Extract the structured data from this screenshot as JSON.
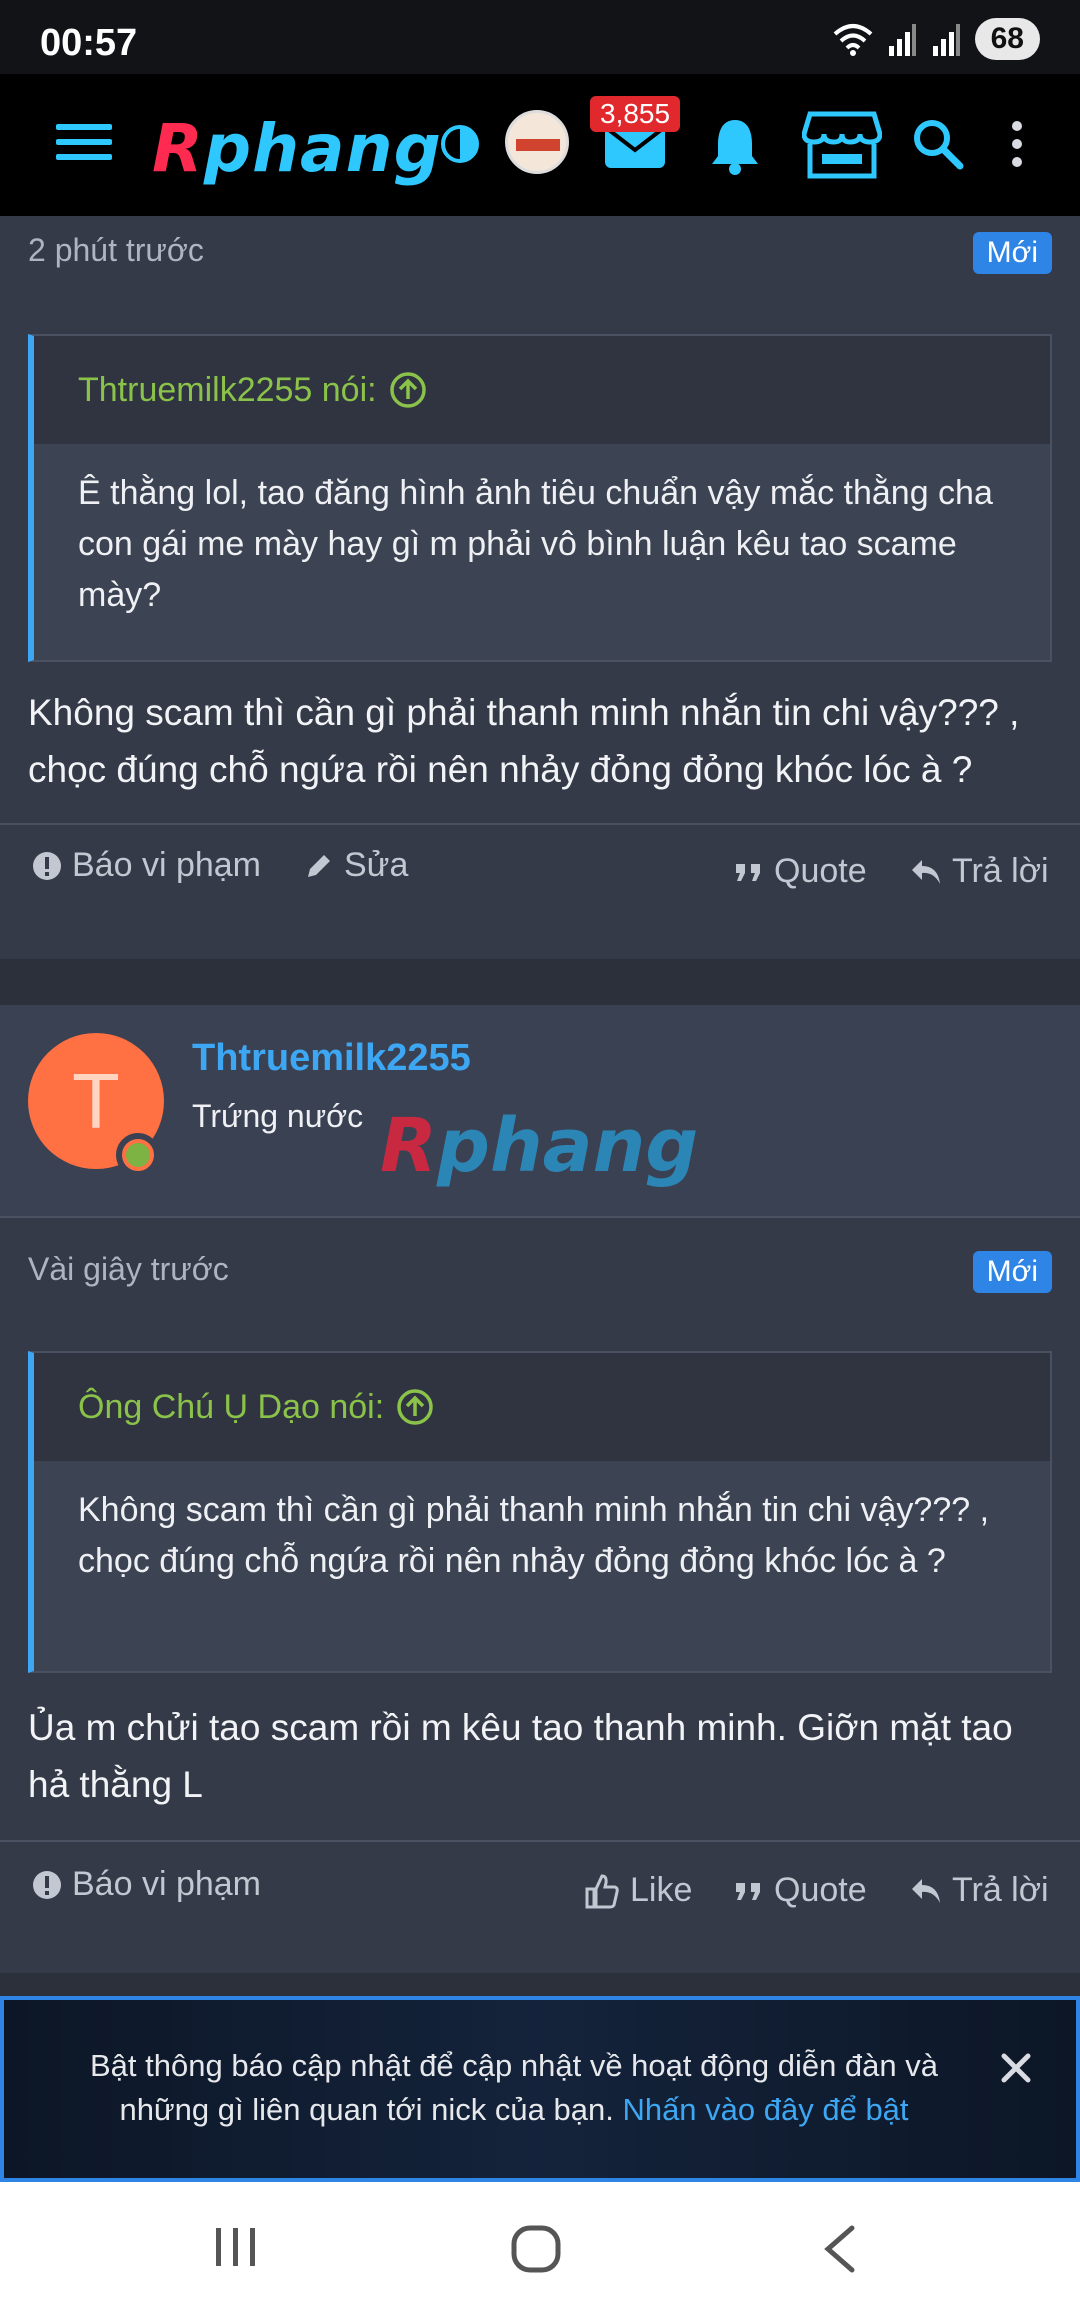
{
  "status_bar": {
    "time": "00:57",
    "battery": "68"
  },
  "topnav": {
    "logo_r": "R",
    "logo_rest": "phang",
    "mail_count": "3,855",
    "icons": [
      "menu-icon",
      "contrast-icon",
      "mail-icon",
      "bell-icon",
      "store-icon",
      "search-icon",
      "more-icon"
    ]
  },
  "post1": {
    "time": "2 phút trước",
    "badge": "Mới",
    "quote_author": "Thtruemilk2255 nói:",
    "quote_text": "Ê thằng lol, tao đăng hình ảnh tiêu chuẩn vậy mắc thằng cha con gái me mày hay gì m phải vô bình luận kêu tao scame mày?",
    "body": "Không scam thì cần gì phải thanh minh nhắn tin chi vậy??? , chọc đúng chỗ ngứa rồi nên nhảy đỏng đỏng khóc lóc à ?",
    "actions": {
      "report": "Báo vi phạm",
      "edit": "Sửa",
      "quote": "Quote",
      "reply": "Trả lời"
    }
  },
  "post2": {
    "avatar_letter": "T",
    "author": "Thtruemilk2255",
    "rank": "Trứng nước",
    "time": "Vài giây trước",
    "badge": "Mới",
    "quote_author": "Ông Chú Ụ Dạo nói:",
    "quote_text": "Không scam thì cần gì phải thanh minh nhắn tin chi vậy??? , chọc đúng chỗ ngứa rồi nên nhảy đỏng đỏng khóc lóc à ?",
    "body": "Ủa m chửi tao scam rồi m kêu tao thanh minh. Giỡn mặt tao hả thằng L",
    "actions": {
      "report": "Báo vi phạm",
      "like": "Like",
      "quote": "Quote",
      "reply": "Trả lời"
    }
  },
  "notification": {
    "text": "Bật thông báo cập nhật để cập nhật về hoạt động diễn đàn và những gì liên quan tới nick của bạn.",
    "link": "Nhấn vào đây để bật"
  },
  "colors": {
    "accent": "#3ea7f3",
    "quote_author": "#8bc34a",
    "badge": "#2f85e6",
    "avatar": "#ff7043"
  }
}
